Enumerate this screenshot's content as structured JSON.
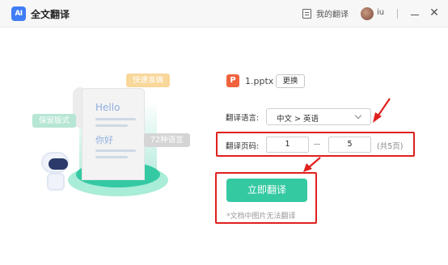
{
  "titlebar": {
    "app_logo_text": "AI",
    "app_name": "全文翻译",
    "my_translations": "我的翻译",
    "user_name": "iu"
  },
  "illustration": {
    "tag_fast": "快速准确",
    "tag_keep_format": "保留版式",
    "tag_languages": "72种语言",
    "paper_hello": "Hello",
    "paper_nihao": "你好"
  },
  "file": {
    "icon_letter": "P",
    "name": "1.pptx",
    "change_label": "更换"
  },
  "language": {
    "label": "翻译语言:",
    "selected": "中文 > 英语"
  },
  "pages": {
    "label": "翻译页码:",
    "start": "1",
    "end": "5",
    "total": "(共5页)"
  },
  "action": {
    "translate_label": "立即翻译",
    "note": "*文档中图片无法翻译"
  },
  "colors": {
    "accent": "#35c9a2",
    "highlight_red": "#e0201d",
    "file_icon": "#f0623c"
  }
}
